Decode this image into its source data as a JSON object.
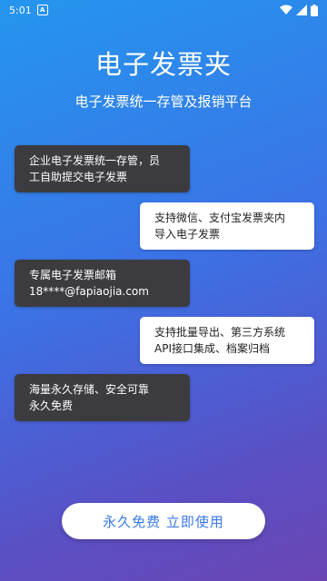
{
  "status": {
    "time": "5:01",
    "notification_letter": "A"
  },
  "title": "电子发票夹",
  "subtitle": "电子发票统一存管及报销平台",
  "features": [
    {
      "line1": "企业电子发票统一存管，员",
      "line2": "工自助提交电子发票"
    },
    {
      "line1": "支持微信、支付宝发票夹内",
      "line2": "导入电子发票"
    },
    {
      "line1": "专属电子发票邮箱",
      "line2": "18****@fapiaojia.com"
    },
    {
      "line1": "支持批量导出、第三方系统",
      "line2": "API接口集成、档案归档"
    },
    {
      "line1": "海量永久存储、安全可靠",
      "line2": "永久免费"
    }
  ],
  "cta_label": "永久免费 立即使用",
  "colors": {
    "accent": "#3a78ea",
    "bubble_dark": "#3c3c40",
    "bubble_light": "#ffffff"
  },
  "icons": {
    "wifi": "wifi-icon",
    "signal": "signal-icon",
    "battery": "battery-icon"
  }
}
